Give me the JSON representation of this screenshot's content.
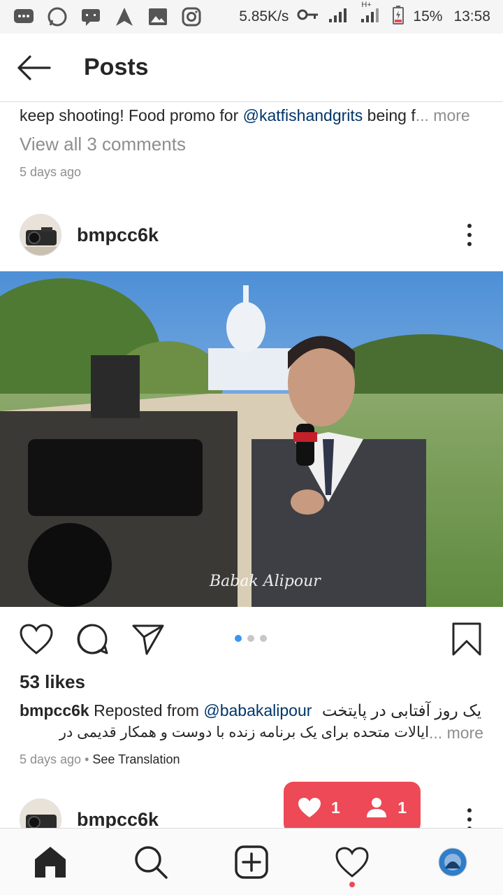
{
  "status_bar": {
    "speed": "5.85K/s",
    "battery": "15%",
    "time": "13:58",
    "network": "H+"
  },
  "header": {
    "title": "Posts"
  },
  "prev_post": {
    "caption_start": "keep shooting! Food promo for ",
    "mention": "@katfishandgrits",
    "caption_end": " being f",
    "more": "... more",
    "view_all": "View all 3 comments",
    "time": "5 days ago"
  },
  "post": {
    "username": "bmpcc6k",
    "photo_watermark": "Babak Alipour",
    "likes": "53 likes",
    "caption_user": "bmpcc6k",
    "caption_reposted": " Reposted from ",
    "caption_mention": "@babakalipour",
    "caption_rtl_1": "یک روز آفتابی در پایتخت",
    "caption_rtl_2": "ایالات متحده برای یک برنامه زنده با دوست و همکار قدیمی در",
    "more": "... more",
    "time": "5 days ago",
    "separator": " • ",
    "see_translation": "See Translation",
    "carousel_count": 3,
    "carousel_active": 0
  },
  "next_post": {
    "username": "bmpcc6k"
  },
  "activity_bubble": {
    "likes": "1",
    "follows": "1"
  },
  "nav": {
    "items": [
      "home-icon",
      "search-icon",
      "new-post-icon",
      "activity-icon",
      "profile-avatar"
    ]
  },
  "colors": {
    "accent": "#3897f0",
    "notification": "#ed4956",
    "mention": "#003569",
    "muted": "#8e8e8e"
  }
}
